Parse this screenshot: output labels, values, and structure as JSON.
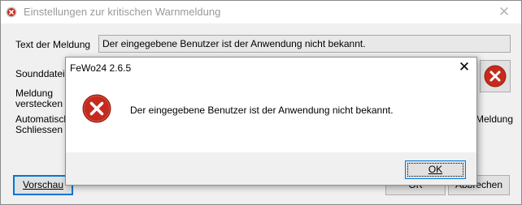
{
  "main_window": {
    "title": "Einstellungen zur kritischen Warnmeldung",
    "close_glyph": "✕",
    "labels": {
      "text": "Text der Meldung",
      "sound": "Sounddatei",
      "hide_line1": "Meldung",
      "hide_line2": "verstecken",
      "auto_line1": "Automatische",
      "auto_line2": "Schliessen",
      "right_fragment": "Meldung"
    },
    "message_text": "Der eingegebene Benutzer ist der Anwendung nicht bekannt.",
    "buttons": {
      "preview": "Vorschau",
      "ok_fragment": "OK",
      "cancel": "Abbrechen"
    }
  },
  "dialog": {
    "title": "FeWo24 2.6.5",
    "close_glyph": "✕",
    "message": "Der eingegebene Benutzer ist der Anwendung nicht bekannt.",
    "ok_label": "OK",
    "icon": "error-icon"
  },
  "colors": {
    "error_red": "#c42b1c",
    "accent": "#0078d7"
  }
}
